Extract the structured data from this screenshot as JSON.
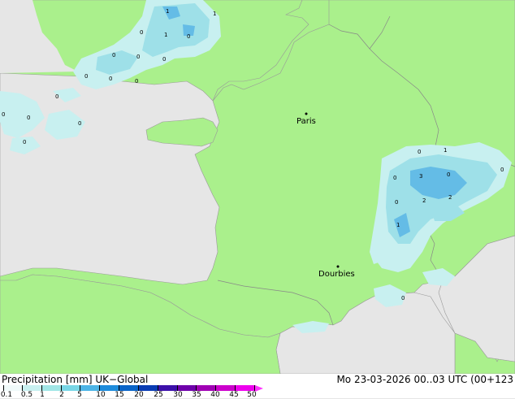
{
  "map": {
    "places": [
      {
        "name": "Paris"
      },
      {
        "name": "Dourbies"
      }
    ],
    "value_labels": [
      "1",
      "1",
      "0",
      "1",
      "0",
      "0",
      "0",
      "0",
      "0",
      "0",
      "0",
      "0",
      "0",
      "0",
      "0",
      "0",
      "0",
      "1",
      "0",
      "3",
      "0",
      "2",
      "2",
      "1",
      "0",
      "0",
      "0"
    ]
  },
  "footer": {
    "title_left": "Precipitation [mm]  UK−Global",
    "title_right": "Mo 23-03-2026 00..03 UTC (00+123",
    "scale_ticks": [
      "0.1",
      "0.5",
      "1",
      "2",
      "5",
      "10",
      "15",
      "20",
      "25",
      "30",
      "35",
      "40",
      "45",
      "50"
    ],
    "scale_colors": [
      "#f0fafa",
      "#c8f0f0",
      "#a0e6e6",
      "#78d6e6",
      "#4cb4e6",
      "#1e8cdc",
      "#0a64c8",
      "#0a3cb4",
      "#3c10aa",
      "#6e00aa",
      "#a000b4",
      "#cc00cc",
      "#ee00ee"
    ]
  },
  "colors": {
    "land": "#aaf08c",
    "sea": "#e6e6e6",
    "border": "#888888",
    "precip_light": "#c8f0f0",
    "precip_mid": "#9ee0e8",
    "precip_heavy": "#64bce6"
  }
}
